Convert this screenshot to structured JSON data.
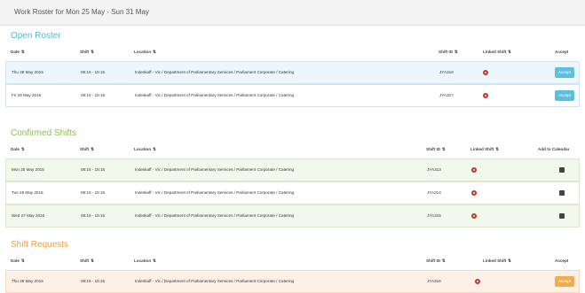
{
  "header": {
    "title": "Work Roster for Mon 25 May - Sun 31 May"
  },
  "sort_glyph": "⇅",
  "open_roster": {
    "title": "Open Roster",
    "columns": {
      "date": "Date",
      "shift": "Shift",
      "location": "Location",
      "shift_id": "Shift ID",
      "linked": "Linked Shift",
      "accept": "Accept"
    },
    "rows": [
      {
        "date": "Thu 28 May 2015",
        "shift": "08:15 - 15:15",
        "location": "Indeskaff - Vic / Department of Parliamentary Services / Parliament Corporate / Catering",
        "shift_id": "JYA316",
        "button": "Accept"
      },
      {
        "date": "Fri 29 May 2015",
        "shift": "08:15 - 15:15",
        "location": "Indeskaff - Vic / Department of Parliamentary Services / Parliament Corporate / Catering",
        "shift_id": "JYA317",
        "button": "Accept"
      }
    ]
  },
  "confirmed_shifts": {
    "title": "Confirmed Shifts",
    "columns": {
      "date": "Date",
      "shift": "Shift",
      "location": "Location",
      "shift_id": "Shift ID",
      "linked": "Linked Shift",
      "calendar": "Add to Calendar"
    },
    "rows": [
      {
        "date": "Mon 25 May 2015",
        "shift": "08:15 - 15:15",
        "location": "Indeskaff - Vic / Department of Parliamentary Services / Parliament Corporate / Catering",
        "shift_id": "JYA313"
      },
      {
        "date": "Tue 26 May 2015",
        "shift": "08:15 - 15:15",
        "location": "Indeskaff - Vic / Department of Parliamentary Services / Parliament Corporate / Catering",
        "shift_id": "JYA314"
      },
      {
        "date": "Wed 27 May 2015",
        "shift": "08:15 - 15:15",
        "location": "Indeskaff - Vic / Department of Parliamentary Services / Parliament Corporate / Catering",
        "shift_id": "JYA315"
      }
    ]
  },
  "shift_requests": {
    "title": "Shift Requests",
    "columns": {
      "date": "Date",
      "shift": "Shift",
      "location": "Location",
      "shift_id": "Shift ID",
      "linked": "Linked Shift",
      "accept": "Accept"
    },
    "rows": [
      {
        "date": "Thu 28 May 2015",
        "shift": "08:15 - 15:15",
        "location": "Indeskaff - Vic / Department of Parliamentary Services / Parliament Corporate / Catering",
        "shift_id": "JYA316",
        "button": "Accept"
      }
    ]
  },
  "colors": {
    "open_title": "#5bb6d9",
    "confirmed_title": "#8cbf54",
    "requests_title": "#f0a040",
    "accept_blue": "#5bc0de",
    "accept_orange": "#f0ad4e",
    "linked_icon": "#c0392b"
  },
  "icons": {
    "linked": "linked-shift-icon",
    "calendar": "calendar-icon",
    "sort": "sort-icon"
  }
}
